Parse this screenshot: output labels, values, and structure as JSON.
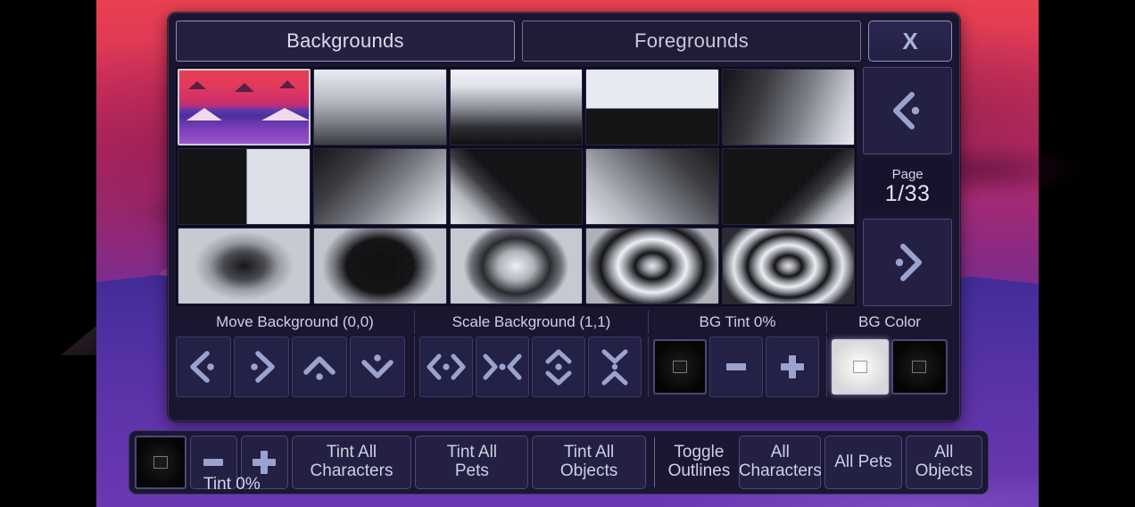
{
  "dialog": {
    "tabs": [
      {
        "label": "Backgrounds",
        "selected": true
      },
      {
        "label": "Foregrounds",
        "selected": false
      }
    ],
    "close_label": "X",
    "close_icon": "close-x-icon"
  },
  "pagination": {
    "prev_icon": "chevron-left-dot-icon",
    "next_icon": "chevron-right-dot-icon",
    "page_label": "Page",
    "page_value": "1/33",
    "current_page": 1,
    "total_pages": 33
  },
  "grid": {
    "columns": 5,
    "rows": 3,
    "selected_index": 0,
    "thumbnails": [
      {
        "name": "mountain-scene",
        "kind": "scene"
      },
      {
        "name": "linear-gradient-vertical-light",
        "kind": "gradient"
      },
      {
        "name": "linear-gradient-vertical-soft",
        "kind": "gradient"
      },
      {
        "name": "split-horizontal-hard",
        "kind": "gradient"
      },
      {
        "name": "linear-gradient-diagonal-right",
        "kind": "gradient"
      },
      {
        "name": "split-vertical-hard",
        "kind": "gradient"
      },
      {
        "name": "linear-gradient-corner-bl",
        "kind": "gradient"
      },
      {
        "name": "diagonal-wedge-up",
        "kind": "gradient"
      },
      {
        "name": "linear-gradient-corner-tr",
        "kind": "gradient"
      },
      {
        "name": "diagonal-wedge-down",
        "kind": "gradient"
      },
      {
        "name": "radial-dark-center",
        "kind": "radial"
      },
      {
        "name": "radial-ellipse-dark",
        "kind": "radial"
      },
      {
        "name": "radial-light-center",
        "kind": "radial"
      },
      {
        "name": "radial-rings-2",
        "kind": "radial"
      },
      {
        "name": "radial-rings-3",
        "kind": "radial"
      }
    ]
  },
  "controls": {
    "sections": [
      {
        "label": "Move Background (0,0)",
        "value": "(0,0)"
      },
      {
        "label": "Scale Background (1,1)",
        "value": "(1,1)"
      },
      {
        "label": "BG Tint 0%",
        "value": "0%"
      },
      {
        "label": "BG Color"
      }
    ],
    "move_buttons": [
      {
        "name": "move-left-button",
        "icon": "chevron-left-dot-icon"
      },
      {
        "name": "move-right-button",
        "icon": "chevron-right-dot-icon"
      },
      {
        "name": "move-up-button",
        "icon": "chevron-up-dot-icon"
      },
      {
        "name": "move-down-button",
        "icon": "chevron-down-dot-icon"
      }
    ],
    "scale_buttons": [
      {
        "name": "scale-width-expand-button",
        "icon": "expand-horizontal-icon"
      },
      {
        "name": "scale-width-shrink-button",
        "icon": "collapse-horizontal-icon"
      },
      {
        "name": "scale-height-expand-button",
        "icon": "expand-vertical-icon"
      },
      {
        "name": "scale-height-shrink-button",
        "icon": "collapse-vertical-icon"
      }
    ],
    "bg_tint": {
      "swatch_name": "bg-tint-swatch",
      "swatch_color": "#0a0a0a",
      "minus_label": "−",
      "plus_label": "+"
    },
    "bg_color": {
      "swatches": [
        {
          "name": "bg-color-white-swatch",
          "color": "#ffffff",
          "selected": true
        },
        {
          "name": "bg-color-black-swatch",
          "color": "#0a0a0a",
          "selected": false
        }
      ]
    }
  },
  "toolbar": {
    "tint_swatch_color": "#0a0a0a",
    "tint_minus_label": "−",
    "tint_plus_label": "+",
    "tint_label": "Tint 0%",
    "tint_value": "0%",
    "buttons": [
      {
        "name": "tint-all-characters-button",
        "line1": "Tint All",
        "line2": "Characters"
      },
      {
        "name": "tint-all-pets-button",
        "line1": "Tint All",
        "line2": "Pets"
      },
      {
        "name": "tint-all-objects-button",
        "line1": "Tint All",
        "line2": "Objects"
      }
    ],
    "toggle_outlines_label_line1": "Toggle",
    "toggle_outlines_label_line2": "Outlines",
    "outline_buttons": [
      {
        "name": "outline-all-characters-button",
        "line1": "All",
        "line2": "Characters"
      },
      {
        "name": "outline-all-pets-button",
        "line1": "All Pets",
        "line2": ""
      },
      {
        "name": "outline-all-objects-button",
        "line1": "All",
        "line2": "Objects"
      }
    ]
  },
  "theme": {
    "panel_bg": "#1a1630",
    "button_bg": "#232044",
    "accent_text": "#ccd0e3",
    "icon_color": "#9aa3cf",
    "border": "#4b4878"
  }
}
